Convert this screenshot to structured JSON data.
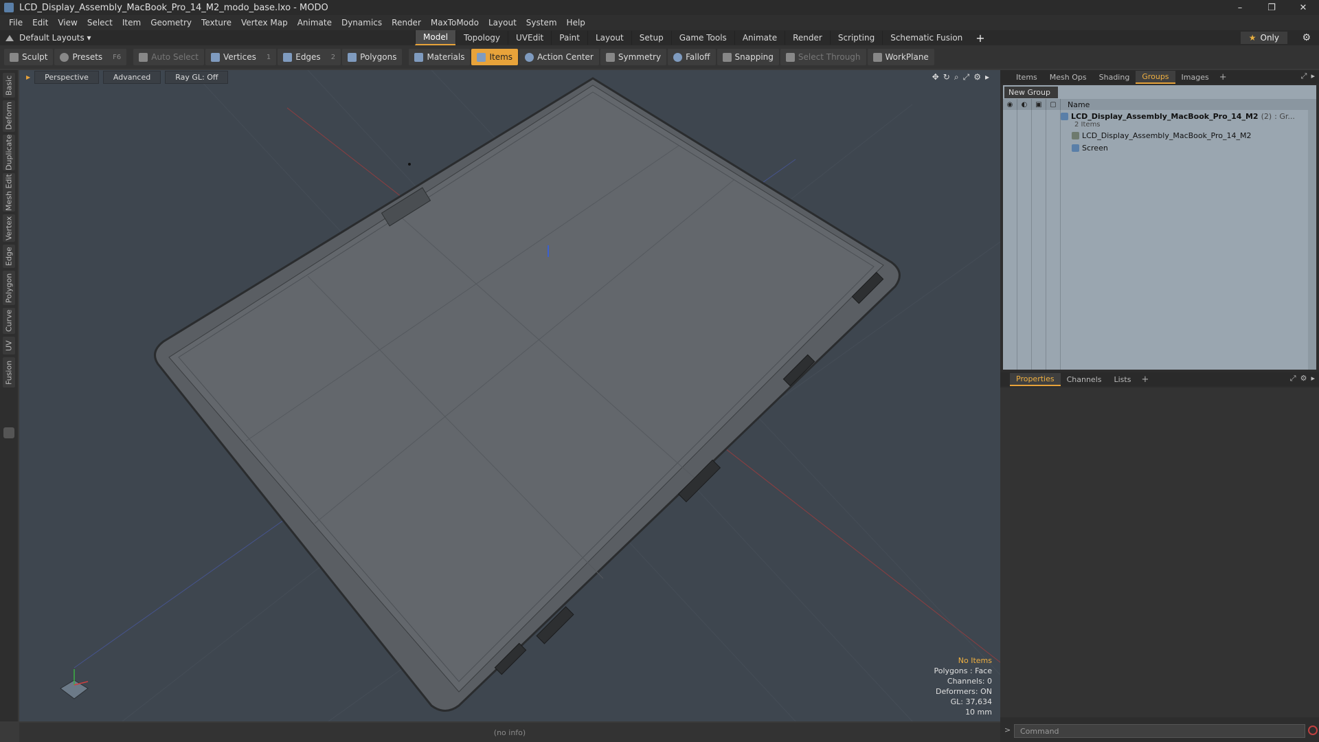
{
  "window": {
    "title": "LCD_Display_Assembly_MacBook_Pro_14_M2_modo_base.lxo - MODO",
    "controls": [
      "–",
      "❐",
      "✕"
    ]
  },
  "menu": [
    "File",
    "Edit",
    "View",
    "Select",
    "Item",
    "Geometry",
    "Texture",
    "Vertex Map",
    "Animate",
    "Dynamics",
    "Render",
    "MaxToModo",
    "Layout",
    "System",
    "Help"
  ],
  "layouts": {
    "label": "Default Layouts ▾"
  },
  "tabs": [
    {
      "label": "Model",
      "active": true
    },
    {
      "label": "Topology"
    },
    {
      "label": "UVEdit"
    },
    {
      "label": "Paint"
    },
    {
      "label": "Layout"
    },
    {
      "label": "Setup"
    },
    {
      "label": "Game Tools"
    },
    {
      "label": "Animate"
    },
    {
      "label": "Render"
    },
    {
      "label": "Scripting"
    },
    {
      "label": "Schematic Fusion"
    }
  ],
  "only_label": "Only",
  "toolbar": {
    "sculpt": "Sculpt",
    "presets": "Presets",
    "presets_key": "F6",
    "auto_select": "Auto Select",
    "vertices": "Vertices",
    "vertices_key": "1",
    "edges": "Edges",
    "edges_key": "2",
    "polygons": "Polygons",
    "materials": "Materials",
    "items": "Items",
    "action_center": "Action Center",
    "symmetry": "Symmetry",
    "falloff": "Falloff",
    "snapping": "Snapping",
    "select_through": "Select Through",
    "workplane": "WorkPlane"
  },
  "left_tabs": [
    "Basic",
    "Deform",
    "Duplicate",
    "Mesh Edit",
    "Vertex",
    "Edge",
    "Polygon",
    "Curve",
    "UV",
    "Fusion"
  ],
  "viewport": {
    "view": "Perspective",
    "shading": "Advanced",
    "raygl": "Ray GL: Off",
    "stats": {
      "items": "No Items",
      "polygons": "Polygons : Face",
      "channels": "Channels: 0",
      "deformers": "Deformers: ON",
      "gl": "GL: 37,634",
      "units": "10 mm"
    }
  },
  "status": "(no info)",
  "panel_top": {
    "tabs": [
      {
        "label": "Items"
      },
      {
        "label": "Mesh Ops"
      },
      {
        "label": "Shading"
      },
      {
        "label": "Groups",
        "active": true
      },
      {
        "label": "Images"
      }
    ],
    "new_group": "New Group",
    "column_name": "Name",
    "rows": {
      "group_name": "LCD_Display_Assembly_MacBook_Pro_14_M2",
      "group_count": "(2)",
      "group_suffix": ": Gr...",
      "group_sub": "2 Items",
      "child1": "LCD_Display_Assembly_MacBook_Pro_14_M2",
      "child2": "Screen"
    }
  },
  "panel_bottom": {
    "tabs": [
      {
        "label": "Properties",
        "active": true
      },
      {
        "label": "Channels"
      },
      {
        "label": "Lists"
      }
    ]
  },
  "command": {
    "prompt": ">",
    "placeholder": "Command"
  }
}
